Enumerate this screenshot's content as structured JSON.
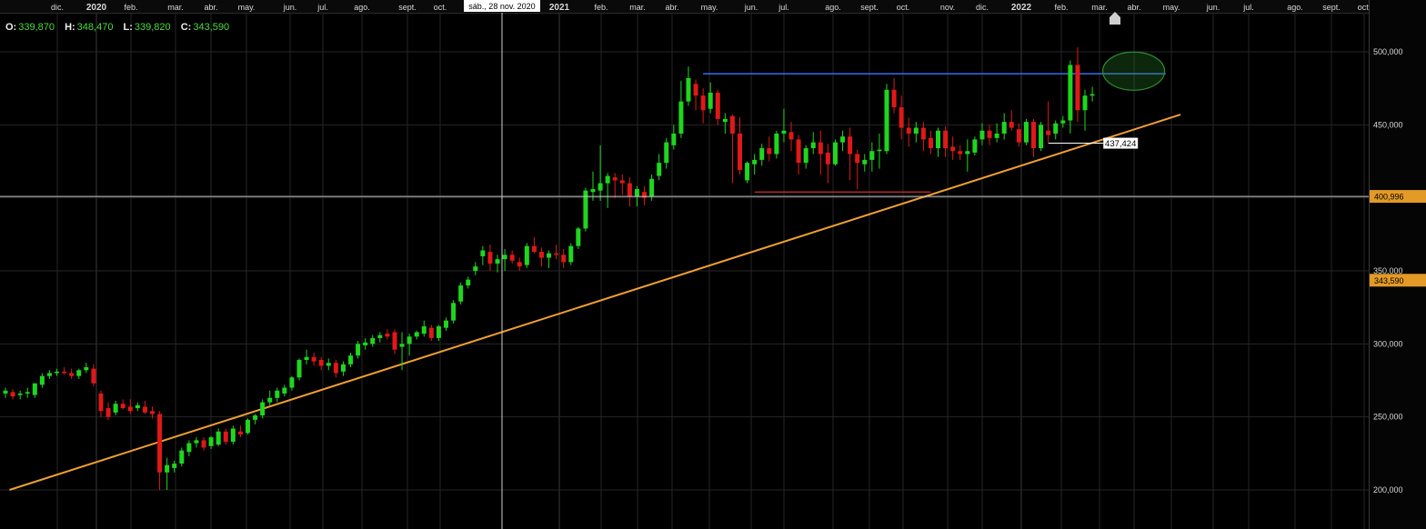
{
  "ohlc": {
    "o_label": "O:",
    "o": "339,870",
    "h_label": "H:",
    "h": "348,470",
    "l_label": "L:",
    "l": "339,820",
    "c_label": "C:",
    "c": "343,590"
  },
  "crosshair": {
    "date_label": "sáb., 28 nov. 2020",
    "price_label": "400,996",
    "price": 400.996
  },
  "last_price": {
    "label": "343,590",
    "value": 343.59
  },
  "colors": {
    "up": "#1fd61f",
    "down": "#e01818",
    "trend": "#f0a030",
    "resistance": "#3a6cf0",
    "support": "#d03030",
    "badge": "#e39a26",
    "highlight": "#2e8b2e"
  },
  "chart_data": {
    "type": "candlestick",
    "interval": "weekly",
    "x_ticks": [
      "dic.",
      "2020",
      "feb.",
      "mar.",
      "abr.",
      "may.",
      "jun.",
      "jul.",
      "ago.",
      "sept.",
      "oct.",
      "2021",
      "feb.",
      "mar.",
      "abr.",
      "may.",
      "jun.",
      "jul.",
      "ago.",
      "sept.",
      "oct.",
      "nov.",
      "dic.",
      "2022",
      "feb.",
      "mar.",
      "abr.",
      "may.",
      "jun.",
      "jul.",
      "ago.",
      "sept.",
      "oct."
    ],
    "y_ticks": [
      "200,000",
      "250,000",
      "300,000",
      "350,000",
      "400,000",
      "450,000",
      "500,000"
    ],
    "y_tick_values": [
      200,
      250,
      300,
      350,
      400,
      450,
      500
    ],
    "ylim": [
      188,
      517
    ],
    "grid": true,
    "candles": [
      {
        "o": 266,
        "h": 270,
        "l": 263,
        "c": 268
      },
      {
        "o": 267,
        "h": 269,
        "l": 262,
        "c": 264
      },
      {
        "o": 265,
        "h": 268,
        "l": 262,
        "c": 266
      },
      {
        "o": 266,
        "h": 270,
        "l": 263,
        "c": 267
      },
      {
        "o": 265,
        "h": 273,
        "l": 263,
        "c": 273
      },
      {
        "o": 272,
        "h": 280,
        "l": 270,
        "c": 278
      },
      {
        "o": 278,
        "h": 282,
        "l": 276,
        "c": 280
      },
      {
        "o": 280,
        "h": 283,
        "l": 278,
        "c": 281
      },
      {
        "o": 281,
        "h": 284,
        "l": 279,
        "c": 280
      },
      {
        "o": 280,
        "h": 283,
        "l": 276,
        "c": 278
      },
      {
        "o": 278,
        "h": 283,
        "l": 276,
        "c": 282
      },
      {
        "o": 282,
        "h": 287,
        "l": 280,
        "c": 284
      },
      {
        "o": 283,
        "h": 286,
        "l": 271,
        "c": 273
      },
      {
        "o": 266,
        "h": 268,
        "l": 250,
        "c": 254
      },
      {
        "o": 256,
        "h": 260,
        "l": 248,
        "c": 250
      },
      {
        "o": 253,
        "h": 261,
        "l": 251,
        "c": 259
      },
      {
        "o": 259,
        "h": 262,
        "l": 255,
        "c": 256
      },
      {
        "o": 257,
        "h": 262,
        "l": 252,
        "c": 254
      },
      {
        "o": 256,
        "h": 260,
        "l": 254,
        "c": 258
      },
      {
        "o": 257,
        "h": 261,
        "l": 252,
        "c": 253
      },
      {
        "o": 254,
        "h": 257,
        "l": 249,
        "c": 252
      },
      {
        "o": 252,
        "h": 254,
        "l": 200,
        "c": 212
      },
      {
        "o": 212,
        "h": 222,
        "l": 200,
        "c": 217
      },
      {
        "o": 215,
        "h": 220,
        "l": 212,
        "c": 218
      },
      {
        "o": 218,
        "h": 229,
        "l": 216,
        "c": 227
      },
      {
        "o": 226,
        "h": 234,
        "l": 223,
        "c": 232
      },
      {
        "o": 232,
        "h": 236,
        "l": 229,
        "c": 234
      },
      {
        "o": 234,
        "h": 236,
        "l": 227,
        "c": 229
      },
      {
        "o": 230,
        "h": 237,
        "l": 228,
        "c": 236
      },
      {
        "o": 231,
        "h": 242,
        "l": 230,
        "c": 240
      },
      {
        "o": 240,
        "h": 242,
        "l": 231,
        "c": 233
      },
      {
        "o": 233,
        "h": 244,
        "l": 231,
        "c": 242
      },
      {
        "o": 240,
        "h": 244,
        "l": 236,
        "c": 238
      },
      {
        "o": 239,
        "h": 249,
        "l": 238,
        "c": 248
      },
      {
        "o": 248,
        "h": 252,
        "l": 245,
        "c": 251
      },
      {
        "o": 251,
        "h": 262,
        "l": 249,
        "c": 260
      },
      {
        "o": 260,
        "h": 268,
        "l": 258,
        "c": 263
      },
      {
        "o": 263,
        "h": 270,
        "l": 260,
        "c": 268
      },
      {
        "o": 266,
        "h": 272,
        "l": 264,
        "c": 270
      },
      {
        "o": 270,
        "h": 278,
        "l": 268,
        "c": 277
      },
      {
        "o": 277,
        "h": 290,
        "l": 275,
        "c": 289
      },
      {
        "o": 289,
        "h": 296,
        "l": 286,
        "c": 291
      },
      {
        "o": 291,
        "h": 294,
        "l": 285,
        "c": 288
      },
      {
        "o": 289,
        "h": 291,
        "l": 282,
        "c": 285
      },
      {
        "o": 285,
        "h": 290,
        "l": 282,
        "c": 287
      },
      {
        "o": 287,
        "h": 289,
        "l": 277,
        "c": 280
      },
      {
        "o": 281,
        "h": 288,
        "l": 278,
        "c": 286
      },
      {
        "o": 286,
        "h": 294,
        "l": 284,
        "c": 292
      },
      {
        "o": 292,
        "h": 302,
        "l": 290,
        "c": 300
      },
      {
        "o": 299,
        "h": 304,
        "l": 296,
        "c": 301
      },
      {
        "o": 300,
        "h": 306,
        "l": 298,
        "c": 304
      },
      {
        "o": 304,
        "h": 308,
        "l": 301,
        "c": 306
      },
      {
        "o": 307,
        "h": 310,
        "l": 303,
        "c": 305
      },
      {
        "o": 308,
        "h": 310,
        "l": 293,
        "c": 296
      },
      {
        "o": 298,
        "h": 308,
        "l": 282,
        "c": 300
      },
      {
        "o": 300,
        "h": 307,
        "l": 292,
        "c": 305
      },
      {
        "o": 305,
        "h": 309,
        "l": 303,
        "c": 308
      },
      {
        "o": 307,
        "h": 316,
        "l": 305,
        "c": 312
      },
      {
        "o": 311,
        "h": 313,
        "l": 302,
        "c": 304
      },
      {
        "o": 304,
        "h": 313,
        "l": 302,
        "c": 312
      },
      {
        "o": 311,
        "h": 318,
        "l": 309,
        "c": 316
      },
      {
        "o": 316,
        "h": 330,
        "l": 314,
        "c": 328
      },
      {
        "o": 329,
        "h": 342,
        "l": 327,
        "c": 340
      },
      {
        "o": 340,
        "h": 346,
        "l": 338,
        "c": 344
      },
      {
        "o": 350,
        "h": 356,
        "l": 347,
        "c": 353
      },
      {
        "o": 360,
        "h": 367,
        "l": 354,
        "c": 364
      },
      {
        "o": 363,
        "h": 368,
        "l": 350,
        "c": 355
      },
      {
        "o": 355,
        "h": 361,
        "l": 349,
        "c": 358
      },
      {
        "o": 358,
        "h": 365,
        "l": 350,
        "c": 361
      },
      {
        "o": 361,
        "h": 364,
        "l": 355,
        "c": 357
      },
      {
        "o": 356,
        "h": 359,
        "l": 350,
        "c": 353
      },
      {
        "o": 354,
        "h": 369,
        "l": 352,
        "c": 367
      },
      {
        "o": 367,
        "h": 373,
        "l": 362,
        "c": 363
      },
      {
        "o": 363,
        "h": 366,
        "l": 353,
        "c": 359
      },
      {
        "o": 359,
        "h": 364,
        "l": 352,
        "c": 362
      },
      {
        "o": 362,
        "h": 368,
        "l": 358,
        "c": 361
      },
      {
        "o": 361,
        "h": 365,
        "l": 352,
        "c": 356
      },
      {
        "o": 356,
        "h": 369,
        "l": 354,
        "c": 367
      },
      {
        "o": 367,
        "h": 380,
        "l": 365,
        "c": 379
      },
      {
        "o": 379,
        "h": 407,
        "l": 377,
        "c": 405
      },
      {
        "o": 404,
        "h": 418,
        "l": 398,
        "c": 406
      },
      {
        "o": 405,
        "h": 436,
        "l": 398,
        "c": 410
      },
      {
        "o": 410,
        "h": 417,
        "l": 393,
        "c": 415
      },
      {
        "o": 414,
        "h": 417,
        "l": 400,
        "c": 412
      },
      {
        "o": 412,
        "h": 416,
        "l": 402,
        "c": 410
      },
      {
        "o": 410,
        "h": 414,
        "l": 394,
        "c": 401
      },
      {
        "o": 401,
        "h": 408,
        "l": 394,
        "c": 406
      },
      {
        "o": 404,
        "h": 408,
        "l": 395,
        "c": 400
      },
      {
        "o": 401,
        "h": 416,
        "l": 398,
        "c": 413
      },
      {
        "o": 415,
        "h": 430,
        "l": 412,
        "c": 424
      },
      {
        "o": 424,
        "h": 441,
        "l": 420,
        "c": 438
      },
      {
        "o": 436,
        "h": 450,
        "l": 433,
        "c": 444
      },
      {
        "o": 444,
        "h": 480,
        "l": 441,
        "c": 466
      },
      {
        "o": 466,
        "h": 490,
        "l": 463,
        "c": 482
      },
      {
        "o": 478,
        "h": 481,
        "l": 460,
        "c": 470
      },
      {
        "o": 470,
        "h": 475,
        "l": 451,
        "c": 460
      },
      {
        "o": 461,
        "h": 479,
        "l": 458,
        "c": 472
      },
      {
        "o": 472,
        "h": 474,
        "l": 450,
        "c": 454
      },
      {
        "o": 452,
        "h": 458,
        "l": 444,
        "c": 454
      },
      {
        "o": 456,
        "h": 457,
        "l": 410,
        "c": 444
      },
      {
        "o": 444,
        "h": 455,
        "l": 416,
        "c": 419
      },
      {
        "o": 412,
        "h": 425,
        "l": 410,
        "c": 424
      },
      {
        "o": 423,
        "h": 430,
        "l": 416,
        "c": 426
      },
      {
        "o": 426,
        "h": 437,
        "l": 422,
        "c": 434
      },
      {
        "o": 434,
        "h": 442,
        "l": 425,
        "c": 430
      },
      {
        "o": 430,
        "h": 446,
        "l": 427,
        "c": 444
      },
      {
        "o": 444,
        "h": 461,
        "l": 438,
        "c": 446
      },
      {
        "o": 445,
        "h": 452,
        "l": 432,
        "c": 440
      },
      {
        "o": 440,
        "h": 443,
        "l": 416,
        "c": 424
      },
      {
        "o": 424,
        "h": 436,
        "l": 420,
        "c": 434
      },
      {
        "o": 434,
        "h": 445,
        "l": 430,
        "c": 438
      },
      {
        "o": 438,
        "h": 446,
        "l": 416,
        "c": 430
      },
      {
        "o": 431,
        "h": 437,
        "l": 410,
        "c": 423
      },
      {
        "o": 423,
        "h": 440,
        "l": 422,
        "c": 438
      },
      {
        "o": 438,
        "h": 446,
        "l": 432,
        "c": 442
      },
      {
        "o": 442,
        "h": 448,
        "l": 412,
        "c": 430
      },
      {
        "o": 430,
        "h": 433,
        "l": 406,
        "c": 424
      },
      {
        "o": 423,
        "h": 430,
        "l": 418,
        "c": 426
      },
      {
        "o": 426,
        "h": 438,
        "l": 418,
        "c": 432
      },
      {
        "o": 432,
        "h": 444,
        "l": 420,
        "c": 433
      },
      {
        "o": 432,
        "h": 478,
        "l": 430,
        "c": 474
      },
      {
        "o": 474,
        "h": 482,
        "l": 458,
        "c": 462
      },
      {
        "o": 462,
        "h": 470,
        "l": 440,
        "c": 448
      },
      {
        "o": 448,
        "h": 455,
        "l": 435,
        "c": 444
      },
      {
        "o": 444,
        "h": 452,
        "l": 438,
        "c": 448
      },
      {
        "o": 448,
        "h": 452,
        "l": 432,
        "c": 440
      },
      {
        "o": 441,
        "h": 446,
        "l": 430,
        "c": 434
      },
      {
        "o": 434,
        "h": 448,
        "l": 428,
        "c": 446
      },
      {
        "o": 446,
        "h": 449,
        "l": 428,
        "c": 434
      },
      {
        "o": 435,
        "h": 442,
        "l": 426,
        "c": 432
      },
      {
        "o": 432,
        "h": 436,
        "l": 426,
        "c": 430
      },
      {
        "o": 430,
        "h": 440,
        "l": 418,
        "c": 432
      },
      {
        "o": 431,
        "h": 442,
        "l": 429,
        "c": 440
      },
      {
        "o": 440,
        "h": 451,
        "l": 436,
        "c": 446
      },
      {
        "o": 446,
        "h": 450,
        "l": 436,
        "c": 441
      },
      {
        "o": 441,
        "h": 451,
        "l": 438,
        "c": 444
      },
      {
        "o": 444,
        "h": 458,
        "l": 440,
        "c": 452
      },
      {
        "o": 452,
        "h": 460,
        "l": 446,
        "c": 448
      },
      {
        "o": 447,
        "h": 451,
        "l": 435,
        "c": 438
      },
      {
        "o": 438,
        "h": 454,
        "l": 436,
        "c": 452
      },
      {
        "o": 452,
        "h": 454,
        "l": 428,
        "c": 434
      },
      {
        "o": 434,
        "h": 452,
        "l": 432,
        "c": 450
      },
      {
        "o": 446,
        "h": 466,
        "l": 438,
        "c": 443
      },
      {
        "o": 444,
        "h": 453,
        "l": 440,
        "c": 451
      },
      {
        "o": 451,
        "h": 456,
        "l": 448,
        "c": 453
      },
      {
        "o": 453,
        "h": 494,
        "l": 444,
        "c": 491
      },
      {
        "o": 491,
        "h": 503,
        "l": 452,
        "c": 460
      },
      {
        "o": 460,
        "h": 474,
        "l": 446,
        "c": 470
      },
      {
        "o": 470,
        "h": 476,
        "l": 466,
        "c": 471
      }
    ],
    "annotations": {
      "trend_line": [
        {
          "week": 0.55,
          "value": 200
        },
        {
          "week": 160,
          "value": 457
        }
      ],
      "resistance_line": {
        "value": 485,
        "from_week": 95,
        "to_week": 158
      },
      "support_line": {
        "value": 404,
        "from_week": 102,
        "to_week": 126
      },
      "highlight_ellipse": {
        "week": 154,
        "value": 488
      },
      "trend_value_label": "437,424",
      "trend_value": 437.424,
      "trend_label_week": 149.5
    }
  }
}
